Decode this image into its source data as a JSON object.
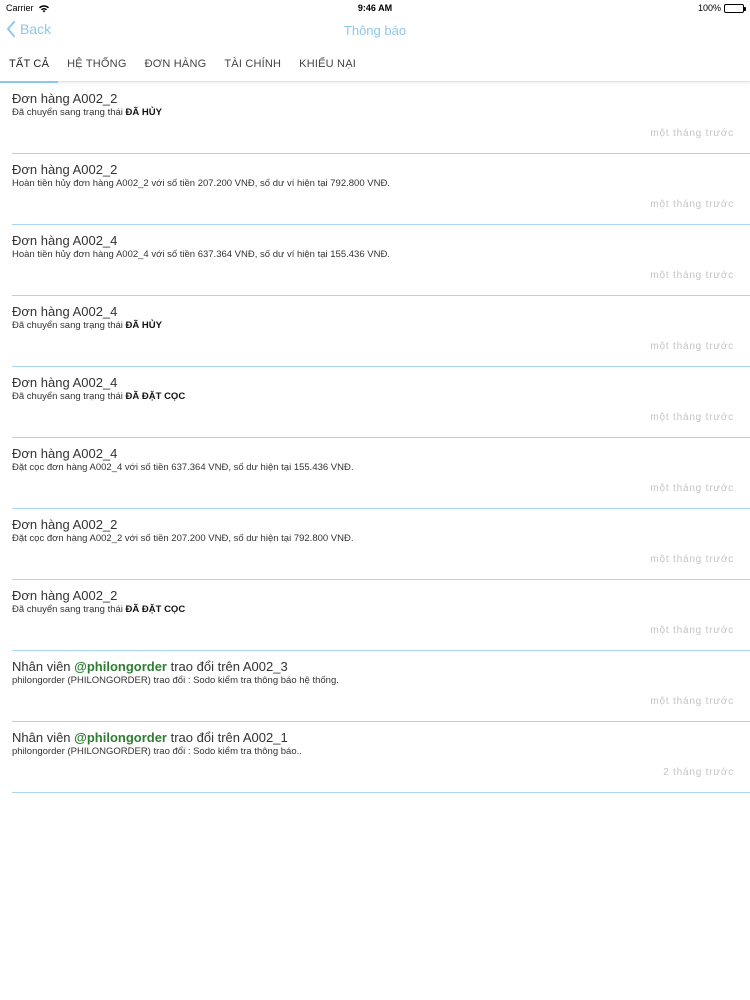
{
  "status_bar": {
    "carrier": "Carrier",
    "time": "9:46 AM",
    "battery": "100%"
  },
  "nav": {
    "back_label": "Back",
    "title": "Thông báo"
  },
  "tabs": [
    {
      "label": "TẤT CẢ",
      "active": true
    },
    {
      "label": "HỆ THỐNG",
      "active": false
    },
    {
      "label": "ĐƠN HÀNG",
      "active": false
    },
    {
      "label": "TÀI CHÍNH",
      "active": false
    },
    {
      "label": "KHIẾU NẠI",
      "active": false
    }
  ],
  "notifications": [
    {
      "title": "Đơn hàng A002_2",
      "body": "Đã chuyển sang trạng thái ",
      "status": "ĐÃ HỦY",
      "time": "một tháng trước"
    },
    {
      "title": "Đơn hàng A002_2",
      "body": "Hoàn tiền hủy đơn hàng A002_2 với số tiền 207.200 VNĐ, số dư ví hiện tại 792.800 VNĐ.",
      "time": "một tháng trước"
    },
    {
      "title": "Đơn hàng A002_4",
      "body": "Hoàn tiền hủy đơn hàng A002_4 với số tiền 637.364 VNĐ, số dư ví hiện tại 155.436 VNĐ.",
      "time": "một tháng trước"
    },
    {
      "title": "Đơn hàng A002_4",
      "body": "Đã chuyển sang trạng thái ",
      "status": "ĐÃ HỦY",
      "time": "một tháng trước"
    },
    {
      "title": "Đơn hàng A002_4",
      "body": "Đã chuyển sang trạng thái ",
      "status": "ĐÃ ĐẶT CỌC",
      "time": "một tháng trước"
    },
    {
      "title": "Đơn hàng A002_4",
      "body": "Đặt cọc đơn hàng A002_4 với số tiền 637.364 VNĐ, số dư hiện tại 155.436 VNĐ.",
      "time": "một tháng trước"
    },
    {
      "title": "Đơn hàng A002_2",
      "body": "Đặt cọc đơn hàng A002_2 với số tiền 207.200 VNĐ, số dư hiện tại 792.800 VNĐ.",
      "time": "một tháng trước"
    },
    {
      "title": "Đơn hàng A002_2",
      "body": "Đã chuyển sang trạng thái ",
      "status": "ĐÃ ĐẶT CỌC",
      "time": "một tháng trước"
    },
    {
      "title_prefix": "Nhân viên ",
      "mention": "@philongorder",
      "title_suffix": " trao đổi trên A002_3",
      "body": "philongorder (PHILONGORDER) trao đổi : Sodo kiểm tra thông báo hệ thống.",
      "time": "một tháng trước"
    },
    {
      "title_prefix": "Nhân viên ",
      "mention": "@philongorder",
      "title_suffix": " trao đổi trên A002_1",
      "body": "philongorder (PHILONGORDER) trao đổi : Sodo kiểm tra thông báo..",
      "time": "2 tháng trước"
    }
  ],
  "colors": {
    "accent": "#8cc8ee",
    "mention": "#2e7d32",
    "divider": "#a9d6f2",
    "time_text": "#c4c4c4"
  },
  "icons": {
    "back": "chevron-left-icon",
    "wifi": "wifi-icon",
    "battery": "battery-icon"
  }
}
